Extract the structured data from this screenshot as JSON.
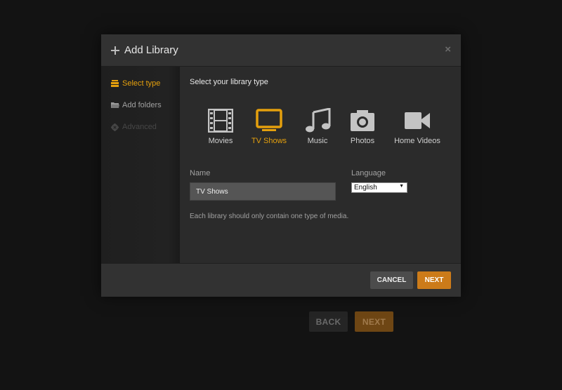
{
  "background": {
    "back_label": "BACK",
    "next_label": "NEXT"
  },
  "modal": {
    "title": "Add Library",
    "close_glyph": "×"
  },
  "sidebar": {
    "items": [
      {
        "label": "Select type",
        "icon": "stack-icon",
        "state": "active"
      },
      {
        "label": "Add folders",
        "icon": "folder-icon",
        "state": "normal"
      },
      {
        "label": "Advanced",
        "icon": "gear-icon",
        "state": "disabled"
      }
    ]
  },
  "content": {
    "heading": "Select your library type",
    "types": [
      {
        "label": "Movies",
        "icon": "film-icon",
        "active": false
      },
      {
        "label": "TV Shows",
        "icon": "tv-icon",
        "active": true
      },
      {
        "label": "Music",
        "icon": "music-note-icon",
        "active": false
      },
      {
        "label": "Photos",
        "icon": "camera-icon",
        "active": false
      },
      {
        "label": "Home Videos",
        "icon": "video-camera-icon",
        "active": false
      }
    ],
    "name_label": "Name",
    "name_value": "TV Shows",
    "language_label": "Language",
    "language_value": "English",
    "hint": "Each library should only contain one type of media."
  },
  "footer": {
    "cancel_label": "CANCEL",
    "next_label": "NEXT"
  },
  "colors": {
    "accent": "#e5a00d",
    "primary_button": "#cc7b19",
    "background": "#131313"
  }
}
